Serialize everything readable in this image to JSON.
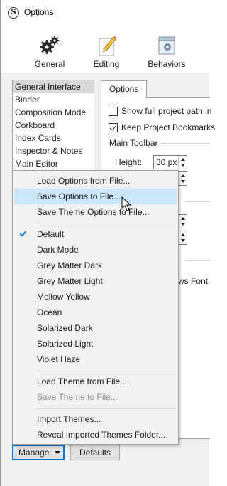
{
  "window": {
    "title": "Options",
    "app_icon": "scrivener-s-icon"
  },
  "toolbar": {
    "items": [
      {
        "label": "General",
        "icon": "gears-icon"
      },
      {
        "label": "Editing",
        "icon": "pencil-paper-icon"
      },
      {
        "label": "Behaviors",
        "icon": "window-gear-icon"
      }
    ]
  },
  "categories": {
    "items": [
      {
        "label": "General Interface",
        "selected": true
      },
      {
        "label": "Binder"
      },
      {
        "label": "Composition Mode"
      },
      {
        "label": "Corkboard"
      },
      {
        "label": "Index Cards"
      },
      {
        "label": "Inspector & Notes"
      },
      {
        "label": "Main Editor"
      }
    ]
  },
  "tab": {
    "label": "Options"
  },
  "options": {
    "show_full_path": {
      "label": "Show full project path in",
      "checked": false
    },
    "keep_bookmarks": {
      "label": "Keep Project Bookmarks",
      "checked": true
    },
    "main_toolbar_label": "Main Toolbar",
    "height_label": "Height:",
    "height_value": "30 px",
    "ws_font_label": "ws Font:"
  },
  "menu": {
    "items": [
      {
        "label": "Load Options from File...",
        "state": "normal"
      },
      {
        "label": "Save Options to File...",
        "state": "highlight"
      },
      {
        "label": "Save Theme Options to File...",
        "state": "normal"
      },
      {
        "label": "Default",
        "state": "checked"
      },
      {
        "label": "Dark Mode",
        "state": "normal"
      },
      {
        "label": "Grey Matter Dark",
        "state": "normal"
      },
      {
        "label": "Grey Matter Light",
        "state": "normal"
      },
      {
        "label": "Mellow Yellow",
        "state": "normal"
      },
      {
        "label": "Ocean",
        "state": "normal"
      },
      {
        "label": "Solarized Dark",
        "state": "normal"
      },
      {
        "label": "Solarized Light",
        "state": "normal"
      },
      {
        "label": "Violet Haze",
        "state": "normal"
      },
      {
        "label": "Load Theme from File...",
        "state": "normal"
      },
      {
        "label": "Save Theme to File...",
        "state": "disabled"
      },
      {
        "label": "Import Themes...",
        "state": "normal"
      },
      {
        "label": "Reveal Imported Themes Folder...",
        "state": "normal"
      }
    ]
  },
  "buttons": {
    "manage": "Manage",
    "defaults": "Defaults"
  },
  "colors": {
    "accent": "#0078d7",
    "highlight": "#cce8ff",
    "selected_category": "#d9d9d9",
    "disabled_text": "#8d8d8d"
  }
}
